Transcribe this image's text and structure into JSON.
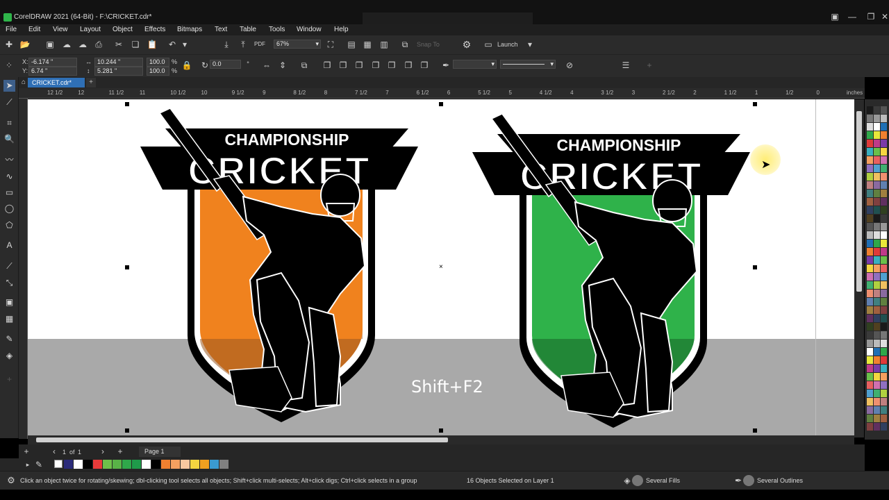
{
  "window": {
    "title": "CorelDRAW 2021 (64-Bit) - F:\\CRICKET.cdr*",
    "controls": [
      "minimize",
      "restore",
      "close"
    ]
  },
  "menu": [
    "File",
    "Edit",
    "View",
    "Layout",
    "Object",
    "Effects",
    "Bitmaps",
    "Text",
    "Table",
    "Tools",
    "Window",
    "Help"
  ],
  "toolbar": {
    "zoom": "67%",
    "launch_label": "Launch",
    "snap_label": "Snap To"
  },
  "property_bar": {
    "x": "-6.174 \"",
    "y": "6.74 \"",
    "width": "10.244 \"",
    "height": "5.281 \"",
    "scale_x": "100.0",
    "scale_y": "100.0",
    "percent": "%",
    "rotation": "0.0"
  },
  "document": {
    "tab_name": "CRICKET.cdr*",
    "ruler_unit": "inches",
    "ruler_labels": [
      "12 1/2",
      "12",
      "11 1/2",
      "11",
      "10 1/2",
      "10",
      "9 1/2",
      "9",
      "8 1/2",
      "8",
      "7 1/2",
      "7",
      "6 1/2",
      "6",
      "5 1/2",
      "5",
      "4 1/2",
      "4",
      "3 1/2",
      "3",
      "2 1/2",
      "2",
      "1 1/2",
      "1",
      "1/2",
      "0"
    ]
  },
  "canvas": {
    "shortcut_overlay": "Shift+F2",
    "logos": [
      {
        "name": "orange-logo",
        "line1": "CHAMPIONSHIP",
        "line2": "CRICKET",
        "shield_color": "#f0821e"
      },
      {
        "name": "green-logo",
        "line1": "CHAMPIONSHIP",
        "line2": "CRICKET",
        "shield_color": "#2fb24a"
      }
    ]
  },
  "pages": {
    "current": "1",
    "of_label": "of",
    "total": "1",
    "tab": "Page 1"
  },
  "swatches": [
    "#2b2b7a",
    "#ffffff",
    "#000000",
    "#e83a3a",
    "#6ec04a",
    "#59b347",
    "#2fa84a",
    "#1f9a4a",
    "#ffffff",
    "#000000",
    "#f08030",
    "#f4a060",
    "#f8c8a0",
    "#f4d640",
    "#f0a020",
    "#3a9ad0",
    "#808080"
  ],
  "status": {
    "hint": "Click an object twice for rotating/skewing; dbl-clicking tool selects all objects; Shift+click multi-selects; Alt+click digs; Ctrl+click selects in a group",
    "selection": "16 Objects Selected on Layer 1",
    "fill": "Several Fills",
    "outline": "Several Outlines"
  }
}
